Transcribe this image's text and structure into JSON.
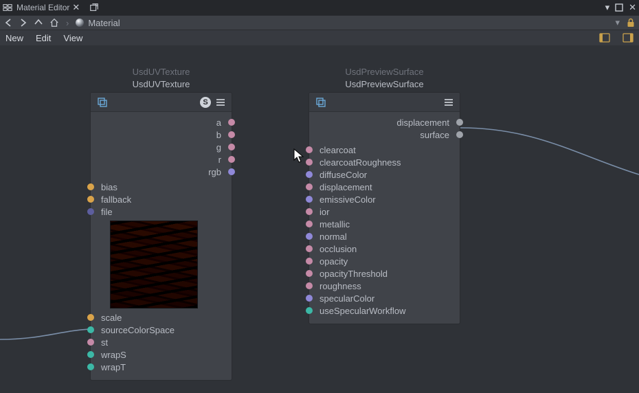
{
  "window": {
    "title": "Material Editor"
  },
  "breadcrumb": {
    "label": "Material"
  },
  "menu": {
    "new": "New",
    "edit": "Edit",
    "view": "View"
  },
  "nodes": {
    "texture": {
      "supertitle": "UsdUVTexture",
      "title": "UsdUVTexture",
      "outputs": [
        {
          "label": "a",
          "color": "c-pink"
        },
        {
          "label": "b",
          "color": "c-pink"
        },
        {
          "label": "g",
          "color": "c-pink"
        },
        {
          "label": "r",
          "color": "c-pink"
        },
        {
          "label": "rgb",
          "color": "c-purple"
        }
      ],
      "inputs_top": [
        {
          "label": "bias",
          "color": "c-orange"
        },
        {
          "label": "fallback",
          "color": "c-orange"
        },
        {
          "label": "file",
          "color": "c-darkpurple"
        }
      ],
      "inputs_bottom": [
        {
          "label": "scale",
          "color": "c-orange"
        },
        {
          "label": "sourceColorSpace",
          "color": "c-teal"
        },
        {
          "label": "st",
          "color": "c-pink"
        },
        {
          "label": "wrapS",
          "color": "c-teal"
        },
        {
          "label": "wrapT",
          "color": "c-teal"
        }
      ]
    },
    "surface": {
      "supertitle": "UsdPreviewSurface",
      "title": "UsdPreviewSurface",
      "outputs": [
        {
          "label": "displacement",
          "color": "c-grey"
        },
        {
          "label": "surface",
          "color": "c-grey"
        }
      ],
      "inputs": [
        {
          "label": "clearcoat",
          "color": "c-pink"
        },
        {
          "label": "clearcoatRoughness",
          "color": "c-pink"
        },
        {
          "label": "diffuseColor",
          "color": "c-purple"
        },
        {
          "label": "displacement",
          "color": "c-pink"
        },
        {
          "label": "emissiveColor",
          "color": "c-purple"
        },
        {
          "label": "ior",
          "color": "c-pink"
        },
        {
          "label": "metallic",
          "color": "c-pink"
        },
        {
          "label": "normal",
          "color": "c-purple"
        },
        {
          "label": "occlusion",
          "color": "c-pink"
        },
        {
          "label": "opacity",
          "color": "c-pink"
        },
        {
          "label": "opacityThreshold",
          "color": "c-pink"
        },
        {
          "label": "roughness",
          "color": "c-pink"
        },
        {
          "label": "specularColor",
          "color": "c-purple"
        },
        {
          "label": "useSpecularWorkflow",
          "color": "c-teal"
        }
      ]
    }
  }
}
